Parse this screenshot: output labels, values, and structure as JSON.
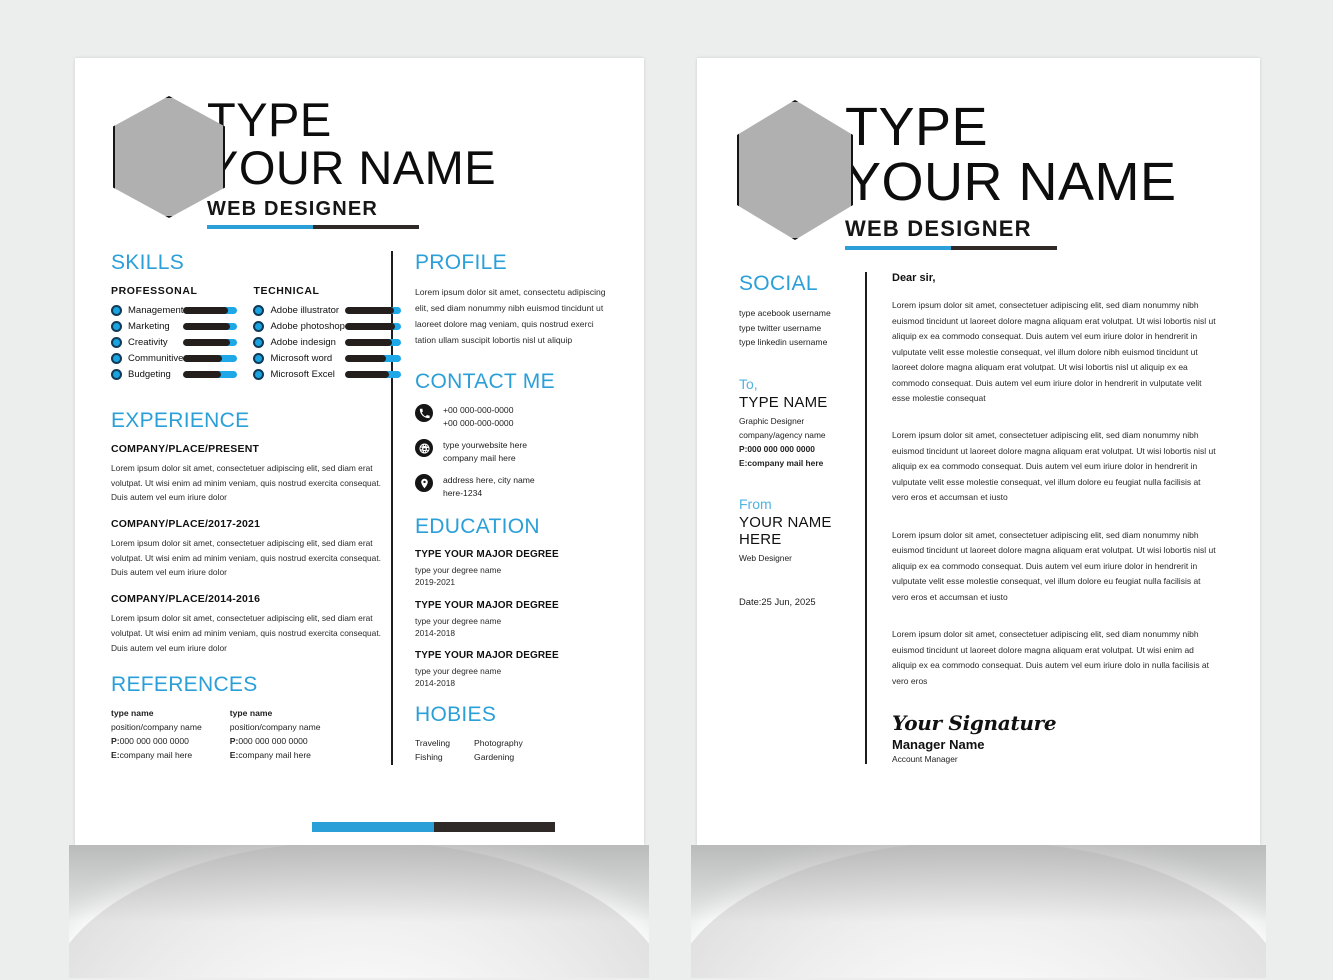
{
  "theme": {
    "accent": "#2a9fd8",
    "dark": "#241f1d",
    "hex_fill": "#b0b0b0"
  },
  "page1": {
    "header": {
      "name_line1": "TYPE",
      "name_line2": "YOUR NAME",
      "role": "WEB DESIGNER"
    },
    "skills": {
      "heading": "SKILLS",
      "professional": {
        "label": "PROFESSONAL",
        "items": [
          {
            "name": "Management",
            "level": 82
          },
          {
            "name": "Marketing",
            "level": 86
          },
          {
            "name": "Creativity",
            "level": 86
          },
          {
            "name": "Communitive",
            "level": 72
          },
          {
            "name": "Budgeting",
            "level": 70
          }
        ]
      },
      "technical": {
        "label": "TECHNICAL",
        "items": [
          {
            "name": "Adobe illustrator",
            "level": 88
          },
          {
            "name": "Adobe photoshop",
            "level": 90
          },
          {
            "name": "Adobe indesign",
            "level": 84
          },
          {
            "name": "Microsoft word",
            "level": 74
          },
          {
            "name": "Microsoft Excel",
            "level": 78
          }
        ]
      }
    },
    "experience": {
      "heading": "EXPERIENCE",
      "items": [
        {
          "title": "COMPANY/PLACE/PRESENT",
          "desc": "Lorem ipsum dolor sit amet, consectetuer adipiscing elit, sed diam erat volutpat. Ut wisi enim ad minim veniam, quis nostrud exercita consequat. Duis autem vel eum iriure dolor"
        },
        {
          "title": "COMPANY/PLACE/2017-2021",
          "desc": "Lorem ipsum dolor sit amet, consectetuer adipiscing elit, sed diam erat volutpat. Ut wisi enim ad minim veniam, quis nostrud exercita consequat. Duis autem vel eum iriure dolor"
        },
        {
          "title": "COMPANY/PLACE/2014-2016",
          "desc": "Lorem ipsum dolor sit amet, consectetuer adipiscing elit, sed diam erat volutpat. Ut wisi enim ad minim veniam, quis nostrud exercita consequat. Duis autem vel eum iriure dolor"
        }
      ]
    },
    "references": {
      "heading": "REFERENCES",
      "items": [
        {
          "name": "type name",
          "position": "position/company name",
          "phone": "000 000 000 0000",
          "email": "company mail here"
        },
        {
          "name": "type name",
          "position": "position/company name",
          "phone": "000 000 000 0000",
          "email": "company mail here"
        }
      ],
      "phone_prefix": "P:",
      "email_prefix": "E:"
    },
    "profile": {
      "heading": "PROFILE",
      "text": "Lorem ipsum dolor sit amet, consectetu adipiscing elit, sed diam nonummy nibh euismod tincidunt ut laoreet dolore mag  veniam, quis nostrud exerci tation ullam suscipit lobortis nisl ut aliquip"
    },
    "contact": {
      "heading": "CONTACT ME",
      "rows": [
        {
          "icon": "phone-icon",
          "line1": "+00 000-000-0000",
          "line2": "+00 000-000-0000"
        },
        {
          "icon": "globe-icon",
          "line1": "type yourwebsite here",
          "line2": "company mail here"
        },
        {
          "icon": "location-icon",
          "line1": "address here, city name",
          "line2": "here-1234"
        }
      ]
    },
    "education": {
      "heading": "EDUCATION",
      "items": [
        {
          "degree": "TYPE YOUR MAJOR DEGREE",
          "name": "type your degree name",
          "years": "2019-2021"
        },
        {
          "degree": "TYPE YOUR MAJOR DEGREE",
          "name": "type your degree name",
          "years": "2014-2018"
        },
        {
          "degree": "TYPE YOUR MAJOR DEGREE",
          "name": "type your degree name",
          "years": "2014-2018"
        }
      ]
    },
    "hobbies": {
      "heading": "HOBIES",
      "col1": [
        "Traveling",
        "Fishing"
      ],
      "col2": [
        "Photography",
        "Gardening"
      ]
    }
  },
  "page2": {
    "header": {
      "name_line1": "TYPE",
      "name_line2": "YOUR NAME",
      "role": "WEB DESIGNER"
    },
    "social": {
      "heading": "SOCIAL",
      "lines": [
        "type acebook username",
        "type twitter username",
        "type linkedin username"
      ]
    },
    "to": {
      "label": "To,",
      "name": "TYPE NAME",
      "title": "Graphic Designer",
      "company": "company/agency name",
      "phone": "P:000 000 000 0000",
      "email": "E:company mail here"
    },
    "from": {
      "label": "From",
      "name": "YOUR NAME HERE",
      "title": "Web Designer"
    },
    "date": "Date:25 Jun, 2025",
    "letter": {
      "salutation": "Dear sir,",
      "paragraphs": [
        "Lorem ipsum dolor sit amet, consectetuer adipiscing elit, sed diam nonummy nibh euismod tincidunt ut laoreet dolore magna aliquam erat volutpat. Ut wisi lobortis nisl ut aliquip ex ea commodo consequat. Duis autem vel eum iriure dolor in hendrerit in vulputate velit esse molestie consequat, vel illum dolore nibh euismod tincidunt ut laoreet dolore magna aliquam erat volutpat. Ut wisi lobortis nisl ut aliquip ex ea commodo consequat. Duis autem vel eum iriure dolor in hendrerit in vulputate velit esse molestie consequat",
        "Lorem ipsum dolor sit amet, consectetuer adipiscing elit, sed diam nonummy nibh euismod tincidunt ut laoreet dolore magna aliquam erat volutpat. Ut wisi lobortis nisl ut aliquip ex ea commodo consequat. Duis autem vel eum iriure dolor in hendrerit in vulputate velit esse molestie consequat, vel illum dolore eu feugiat nulla facilisis at vero eros et accumsan et iusto",
        "Lorem ipsum dolor sit amet, consectetuer adipiscing elit, sed diam nonummy nibh euismod tincidunt ut laoreet dolore magna aliquam erat volutpat. Ut wisi lobortis nisl ut aliquip ex ea commodo consequat. Duis autem vel eum iriure dolor in hendrerit in vulputate velit esse molestie consequat, vel illum dolore eu feugiat nulla facilisis at vero eros et accumsan et iusto",
        "Lorem ipsum dolor sit amet, consectetuer adipiscing elit, sed diam nonummy nibh euismod tincidunt ut laoreet dolore magna aliquam erat volutpat. Ut wisi enim ad aliquip ex ea commodo consequat. Duis autem vel eum iriure dolo in nulla facilisis at vero eros"
      ],
      "signature": "Your Signature",
      "signer_name": "Manager Name",
      "signer_role": "Account Manager"
    }
  }
}
